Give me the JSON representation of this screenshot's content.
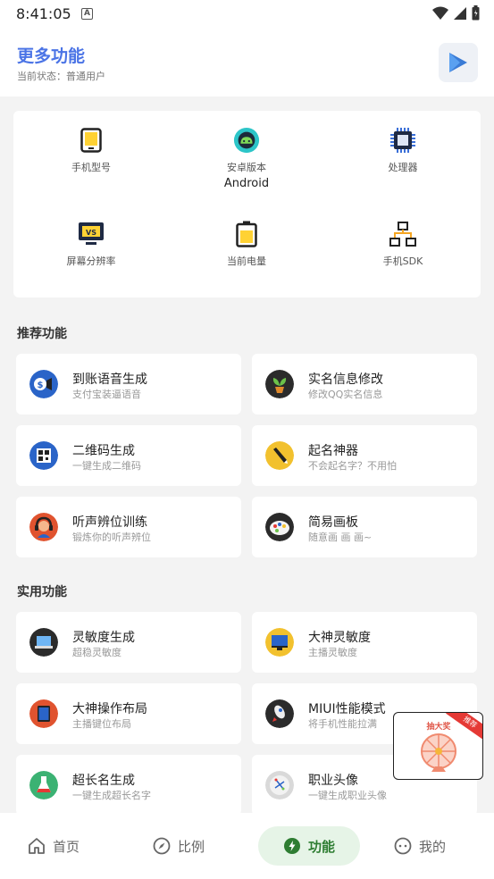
{
  "status": {
    "time": "8:41:05",
    "notification_letter": "A"
  },
  "header": {
    "title": "更多功能",
    "subtitle": "当前状态：普通用户"
  },
  "device_info": [
    {
      "label": "手机型号",
      "value": "",
      "icon": "phone-icon"
    },
    {
      "label": "安卓版本",
      "value": "Android",
      "icon": "android-icon"
    },
    {
      "label": "处理器",
      "value": "",
      "icon": "cpu-icon"
    },
    {
      "label": "屏幕分辨率",
      "value": "",
      "icon": "monitor-icon"
    },
    {
      "label": "当前电量",
      "value": "",
      "icon": "battery-icon"
    },
    {
      "label": "手机SDK",
      "value": "",
      "icon": "sdk-icon"
    }
  ],
  "sections": {
    "recommended": "推荐功能",
    "practical": "实用功能"
  },
  "recommended": [
    {
      "title": "到账语音生成",
      "sub": "支付宝装逼语音",
      "icon": "money-voice-icon"
    },
    {
      "title": "实名信息修改",
      "sub": "修改QQ实名信息",
      "icon": "plant-icon"
    },
    {
      "title": "二维码生成",
      "sub": "一键生成二维码",
      "icon": "qrcode-icon"
    },
    {
      "title": "起名神器",
      "sub": "不会起名字？不用怕",
      "icon": "pen-icon"
    },
    {
      "title": "听声辨位训练",
      "sub": "锻炼你的听声辨位",
      "icon": "headphone-icon"
    },
    {
      "title": "简易画板",
      "sub": "随意画 画 画~",
      "icon": "palette-icon"
    }
  ],
  "practical": [
    {
      "title": "灵敏度生成",
      "sub": "超稳灵敏度",
      "icon": "laptop-icon"
    },
    {
      "title": "大神灵敏度",
      "sub": "主播灵敏度",
      "icon": "desktop-icon"
    },
    {
      "title": "大神操作布局",
      "sub": "主播键位布局",
      "icon": "tablet-icon"
    },
    {
      "title": "MIUI性能模式",
      "sub": "将手机性能拉满",
      "icon": "rocket-icon"
    },
    {
      "title": "超长名生成",
      "sub": "一键生成超长名字",
      "icon": "flask-icon"
    },
    {
      "title": "职业头像",
      "sub": "一键生成职业头像",
      "icon": "avatar-icon"
    }
  ],
  "promo": {
    "title": "抽大奖",
    "badge": "推荐"
  },
  "tabs": [
    {
      "label": "首页",
      "icon": "home-icon"
    },
    {
      "label": "比例",
      "icon": "compass-icon"
    },
    {
      "label": "功能",
      "icon": "bolt-icon"
    },
    {
      "label": "我的",
      "icon": "face-icon"
    }
  ],
  "colors": {
    "accent": "#4b74e6",
    "active_tab_bg": "#e6f4e7",
    "active_tab_fg": "#2e7d32"
  }
}
